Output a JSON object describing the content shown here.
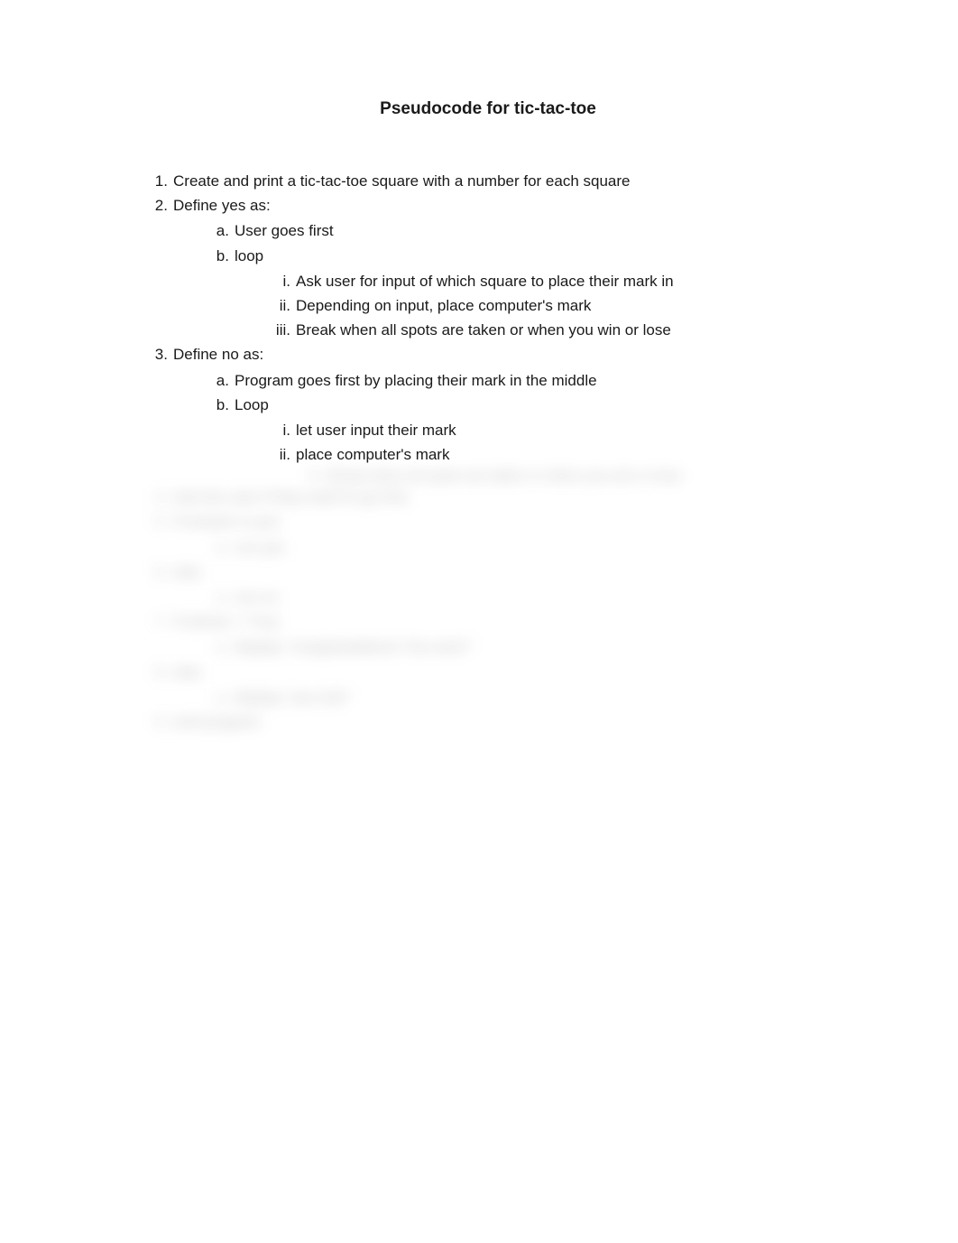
{
  "title": "Pseudocode for tic-tac-toe",
  "items": {
    "i1": "Create and print a tic-tac-toe square with a number for each square",
    "i2": "Define yes as:",
    "i2a": "User goes first",
    "i2b": "loop",
    "i2bi": "Ask user for input of which square to place their mark in",
    "i2bii": "Depending on input, place computer's mark",
    "i2biii": "Break when all spots are taken or when you win or lose",
    "i3": "Define no as:",
    "i3a": "Program goes first by placing their mark in the middle",
    "i3b": "Loop",
    "i3bi": "let user input their mark",
    "i3bii": "place computer's mark"
  },
  "blurred": {
    "b3biii": "Break when all spots are taken or when you win or lose",
    "b4": "Ask the user if they want to go first",
    "b5": "If answer is yes",
    "b5a": "run yes",
    "b6": "else",
    "b6a": "run no",
    "b7": "If winner = True",
    "b7a": "display \"congratulations! You won!\"",
    "b8": "else",
    "b8a": "display \"you lost\"",
    "b9": "end program"
  }
}
